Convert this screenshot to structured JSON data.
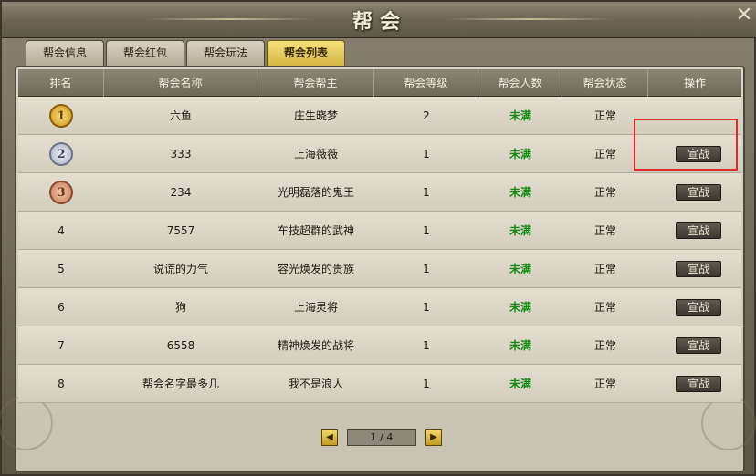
{
  "window": {
    "title": "帮会"
  },
  "tabs": [
    {
      "label": "帮会信息",
      "active": false
    },
    {
      "label": "帮会红包",
      "active": false
    },
    {
      "label": "帮会玩法",
      "active": false
    },
    {
      "label": "帮会列表",
      "active": true
    }
  ],
  "table": {
    "columns": [
      "排名",
      "帮会名称",
      "帮会帮主",
      "帮会等级",
      "帮会人数",
      "帮会状态",
      "操作"
    ],
    "rows": [
      {
        "rank": "1",
        "medal": "gold",
        "name": "六鱼",
        "leader": "庄生晓梦",
        "level": "2",
        "members": "未满",
        "status": "正常",
        "action": ""
      },
      {
        "rank": "2",
        "medal": "silver",
        "name": "333",
        "leader": "上海薇薇",
        "level": "1",
        "members": "未满",
        "status": "正常",
        "action": "宣战"
      },
      {
        "rank": "3",
        "medal": "bronze",
        "name": "234",
        "leader": "光明磊落的鬼王",
        "level": "1",
        "members": "未满",
        "status": "正常",
        "action": "宣战"
      },
      {
        "rank": "4",
        "medal": "",
        "name": "7557",
        "leader": "车技超群的武神",
        "level": "1",
        "members": "未满",
        "status": "正常",
        "action": "宣战"
      },
      {
        "rank": "5",
        "medal": "",
        "name": "说谎的力气",
        "leader": "容光焕发的贵族",
        "level": "1",
        "members": "未满",
        "status": "正常",
        "action": "宣战"
      },
      {
        "rank": "6",
        "medal": "",
        "name": "狗",
        "leader": "上海灵将",
        "level": "1",
        "members": "未满",
        "status": "正常",
        "action": "宣战"
      },
      {
        "rank": "7",
        "medal": "",
        "name": "6558",
        "leader": "精神焕发的战将",
        "level": "1",
        "members": "未满",
        "status": "正常",
        "action": "宣战"
      },
      {
        "rank": "8",
        "medal": "",
        "name": "帮会名字最多几",
        "leader": "我不是浪人",
        "level": "1",
        "members": "未满",
        "status": "正常",
        "action": "宣战"
      }
    ]
  },
  "pager": {
    "current": "1 / 4",
    "prev": "◀",
    "next": "▶"
  },
  "icons": {
    "close": "close-icon",
    "medal": "rank-medal-icon"
  },
  "colors": {
    "members_status": "#138a13",
    "active_tab": "#f4e07a",
    "highlight_box": "#e02a2a"
  }
}
